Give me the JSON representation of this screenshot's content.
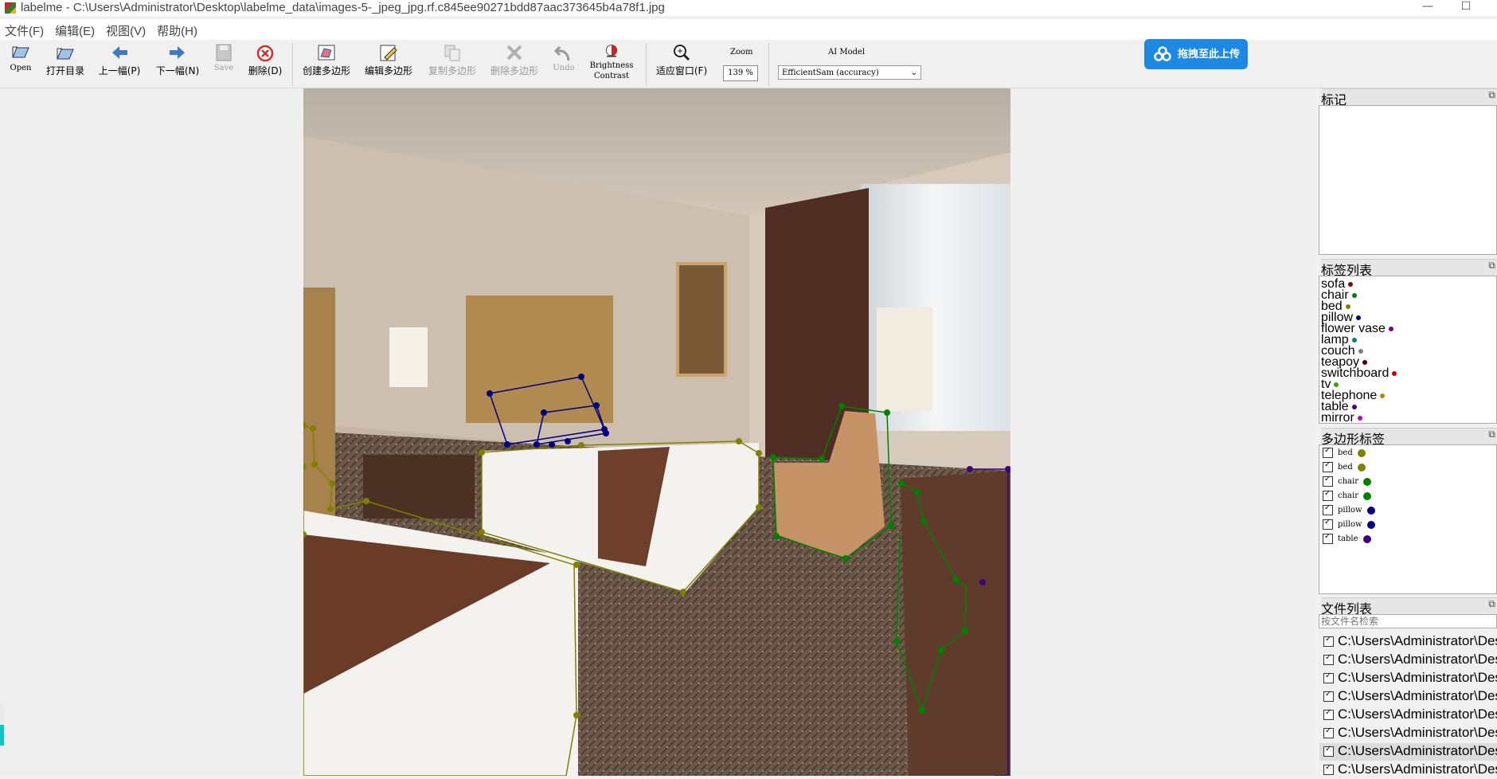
{
  "window": {
    "title": "labelme - C:\\Users\\Administrator\\Desktop\\labelme_data\\images-5-_jpeg_jpg.rf.c845ee90271bdd87aac373645b4a78f1.jpg",
    "minimize_glyph": "—",
    "maximize_glyph": "☐"
  },
  "menu": [
    "文件(F)",
    "编辑(E)",
    "视图(V)",
    "帮助(H)"
  ],
  "toolbar": {
    "open": "Open",
    "open_dir": "打开目录",
    "prev": "上一幅(P)",
    "next": "下一幅(N)",
    "save": "Save",
    "delete_file": "删除(D)",
    "create_polygon": "创建多边形",
    "edit_polygon": "编辑多边形",
    "copy_polygon": "复制多边形",
    "delete_polygon": "删除多边形",
    "undo": "Undo",
    "brightness_1": "Brightness",
    "brightness_2": "Contrast",
    "fit_window": "适应窗口(F)",
    "zoom_label": "Zoom",
    "zoom_value": "139 %",
    "ai_model_label": "AI Model",
    "ai_model_value": "EfficientSam (accuracy)",
    "upload_label": "拖拽至此上传"
  },
  "dock": {
    "flags_title": "标记",
    "labels_title": "标签列表",
    "polygons_title": "多边形标签",
    "files_title": "文件列表",
    "file_search_placeholder": "按文件名检索",
    "float_glyph": "⧉"
  },
  "label_list": [
    {
      "name": "sofa",
      "color": "#8b0000"
    },
    {
      "name": "chair",
      "color": "#008000"
    },
    {
      "name": "bed",
      "color": "#808000"
    },
    {
      "name": "pillow",
      "color": "#000080"
    },
    {
      "name": "flower vase",
      "color": "#800080"
    },
    {
      "name": "lamp",
      "color": "#008080"
    },
    {
      "name": "couch",
      "color": "#808080"
    },
    {
      "name": "teapoy",
      "color": "#400000"
    },
    {
      "name": "switchboard",
      "color": "#c00000"
    },
    {
      "name": "tv",
      "color": "#40a000"
    },
    {
      "name": "telephone",
      "color": "#c08000"
    },
    {
      "name": "table",
      "color": "#400080"
    },
    {
      "name": "mirror",
      "color": "#c000c0"
    }
  ],
  "polygon_labels": [
    {
      "name": "bed",
      "color": "#808000"
    },
    {
      "name": "bed",
      "color": "#808000"
    },
    {
      "name": "chair",
      "color": "#008000"
    },
    {
      "name": "chair",
      "color": "#008000"
    },
    {
      "name": "pillow",
      "color": "#000080"
    },
    {
      "name": "pillow",
      "color": "#000080"
    },
    {
      "name": "table",
      "color": "#400080"
    }
  ],
  "files": [
    {
      "path": "C:\\Users\\Administrator\\Desktop",
      "selected": false
    },
    {
      "path": "C:\\Users\\Administrator\\Desktop",
      "selected": false
    },
    {
      "path": "C:\\Users\\Administrator\\Desktop",
      "selected": false
    },
    {
      "path": "C:\\Users\\Administrator\\Desktop",
      "selected": false
    },
    {
      "path": "C:\\Users\\Administrator\\Desktop",
      "selected": false
    },
    {
      "path": "C:\\Users\\Administrator\\Desktop",
      "selected": false
    },
    {
      "path": "C:\\Users\\Administrator\\Desktop",
      "selected": true
    },
    {
      "path": "C:\\Users\\Administrator\\Desktop",
      "selected": false
    }
  ],
  "colors": {
    "bed": "#808000",
    "chair": "#008000",
    "pillow": "#000080",
    "table": "#400080",
    "accent": "#1e88e5",
    "scroll_marker": "#13c2c2"
  }
}
